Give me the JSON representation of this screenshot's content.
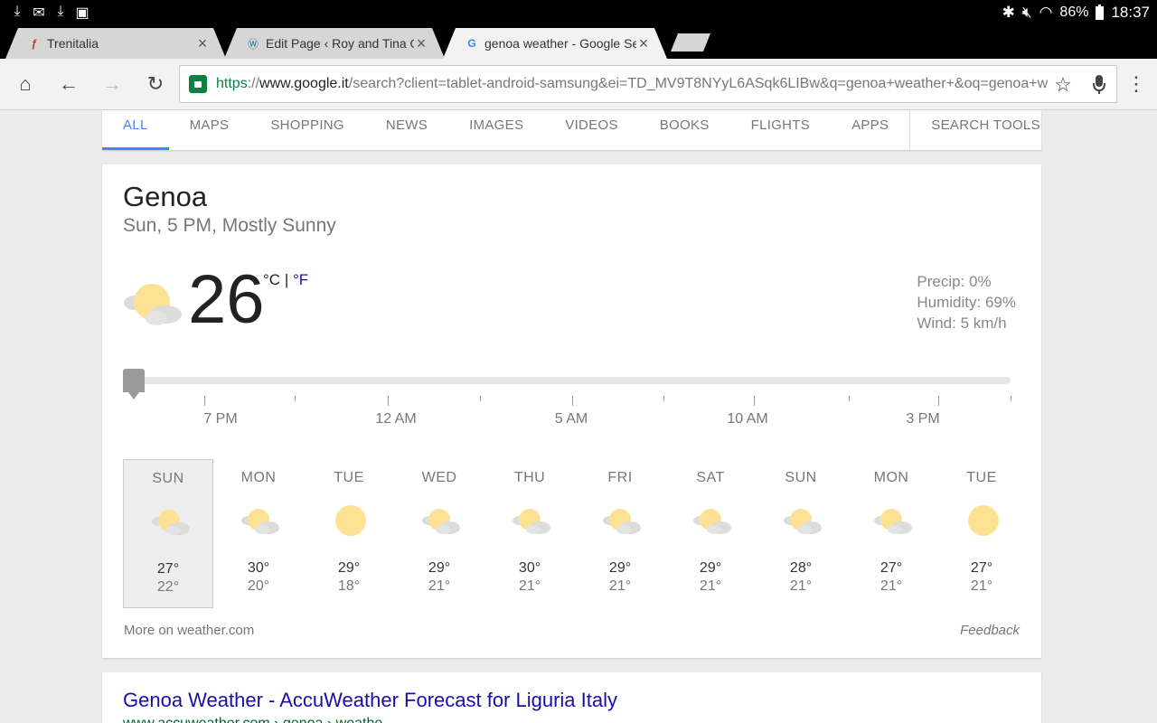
{
  "status_bar": {
    "battery": "86%",
    "time": "18:37",
    "icons": [
      "download-icon",
      "email-icon",
      "download-icon",
      "media-icon"
    ],
    "right_icons": [
      "bluetooth-icon",
      "mute-icon",
      "wifi-icon"
    ]
  },
  "tabs": [
    {
      "title": "Trenitalia",
      "favicon": "trenitalia-icon"
    },
    {
      "title": "Edit Page ‹ Roy and Tina Out",
      "favicon": "wordpress-icon"
    },
    {
      "title": "genoa weather - Google Sear",
      "favicon": "google-icon",
      "active": true
    }
  ],
  "toolbar": {
    "url_scheme": "https",
    "url_sep": "://",
    "url_host": "www.google.it",
    "url_path": "/search?client=tablet-android-samsung&ei=TD_MV9T8NYyL6ASqk6LIBw&q=genoa+weather+&oq=genoa+w"
  },
  "search_tabs": [
    "ALL",
    "MAPS",
    "SHOPPING",
    "NEWS",
    "IMAGES",
    "VIDEOS",
    "BOOKS",
    "FLIGHTS",
    "APPS",
    "SEARCH TOOLS"
  ],
  "weather": {
    "city": "Genoa",
    "condition": "Sun, 5 PM, Mostly Sunny",
    "temperature": "26",
    "unit_c": "°C",
    "unit_sep": "|",
    "unit_f": "°F",
    "precip": "Precip: 0%",
    "humidity": "Humidity: 69%",
    "wind": "Wind: 5 km/h",
    "timeline_labels": [
      "7 PM",
      "12 AM",
      "5 AM",
      "10 AM",
      "3 PM"
    ],
    "days": [
      {
        "name": "SUN",
        "hi": "27°",
        "lo": "22°",
        "icon": "partly-sunny-icon"
      },
      {
        "name": "MON",
        "hi": "30°",
        "lo": "20°",
        "icon": "partly-sunny-icon"
      },
      {
        "name": "TUE",
        "hi": "29°",
        "lo": "18°",
        "icon": "sunny-icon"
      },
      {
        "name": "WED",
        "hi": "29°",
        "lo": "21°",
        "icon": "partly-sunny-icon"
      },
      {
        "name": "THU",
        "hi": "30°",
        "lo": "21°",
        "icon": "partly-sunny-icon"
      },
      {
        "name": "FRI",
        "hi": "29°",
        "lo": "21°",
        "icon": "partly-sunny-icon"
      },
      {
        "name": "SAT",
        "hi": "29°",
        "lo": "21°",
        "icon": "partly-sunny-icon"
      },
      {
        "name": "SUN",
        "hi": "28°",
        "lo": "21°",
        "icon": "partly-sunny-icon"
      },
      {
        "name": "MON",
        "hi": "27°",
        "lo": "21°",
        "icon": "partly-sunny-icon"
      },
      {
        "name": "TUE",
        "hi": "27°",
        "lo": "21°",
        "icon": "sunny-icon"
      }
    ],
    "more_link": "More on weather.com",
    "feedback": "Feedback"
  },
  "result": {
    "title": "Genoa Weather - AccuWeather Forecast for Liguria Italy",
    "url": "www.accuweather.com › genoa › weathe"
  },
  "colors": {
    "accent": "#4285f4",
    "link": "#1a0dab",
    "secure": "#0b8043",
    "sun": "#fde293"
  }
}
